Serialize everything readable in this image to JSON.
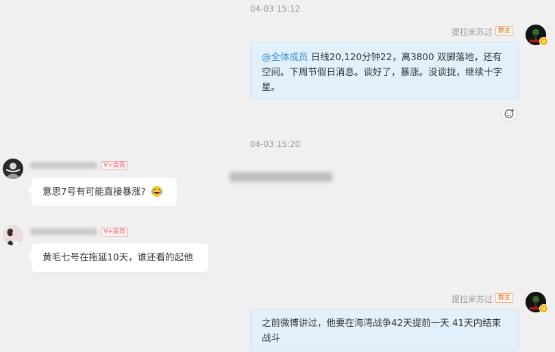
{
  "timestamps": [
    "04-03 15:12",
    "04-03 15:20"
  ],
  "messages": [
    {
      "sender": "提拉米苏过",
      "badge": "群主",
      "mention": "@全体成员",
      "text": " 日线20,120分钟22，离3800 双脚落地，还有空间。下周节假日消息。谈好了，暴涨。没谈拢，继续十字星。"
    },
    {
      "badge": "V+会员",
      "text": "意思7号有可能直接暴涨?",
      "emoji": "laughing-tears-emoji"
    },
    {
      "badge": "V+会员",
      "text": "黄毛七号在拖延10天，谁还看的起他"
    },
    {
      "sender": "提拉米苏过",
      "badge": "群主",
      "text": "之前微博讲过，他要在海湾战争42天提前一天 41天内结束战斗"
    }
  ],
  "icons": {
    "reaction": "add-reaction-icon",
    "verified": "verified-v-icon"
  },
  "colors": {
    "background": "#f0f0f0",
    "right_bubble": "#e1f0fb",
    "left_bubble": "#ffffff",
    "mention": "#2f8fd6",
    "owner_badge": "#e6742f",
    "vip_badge": "#f0575c"
  }
}
